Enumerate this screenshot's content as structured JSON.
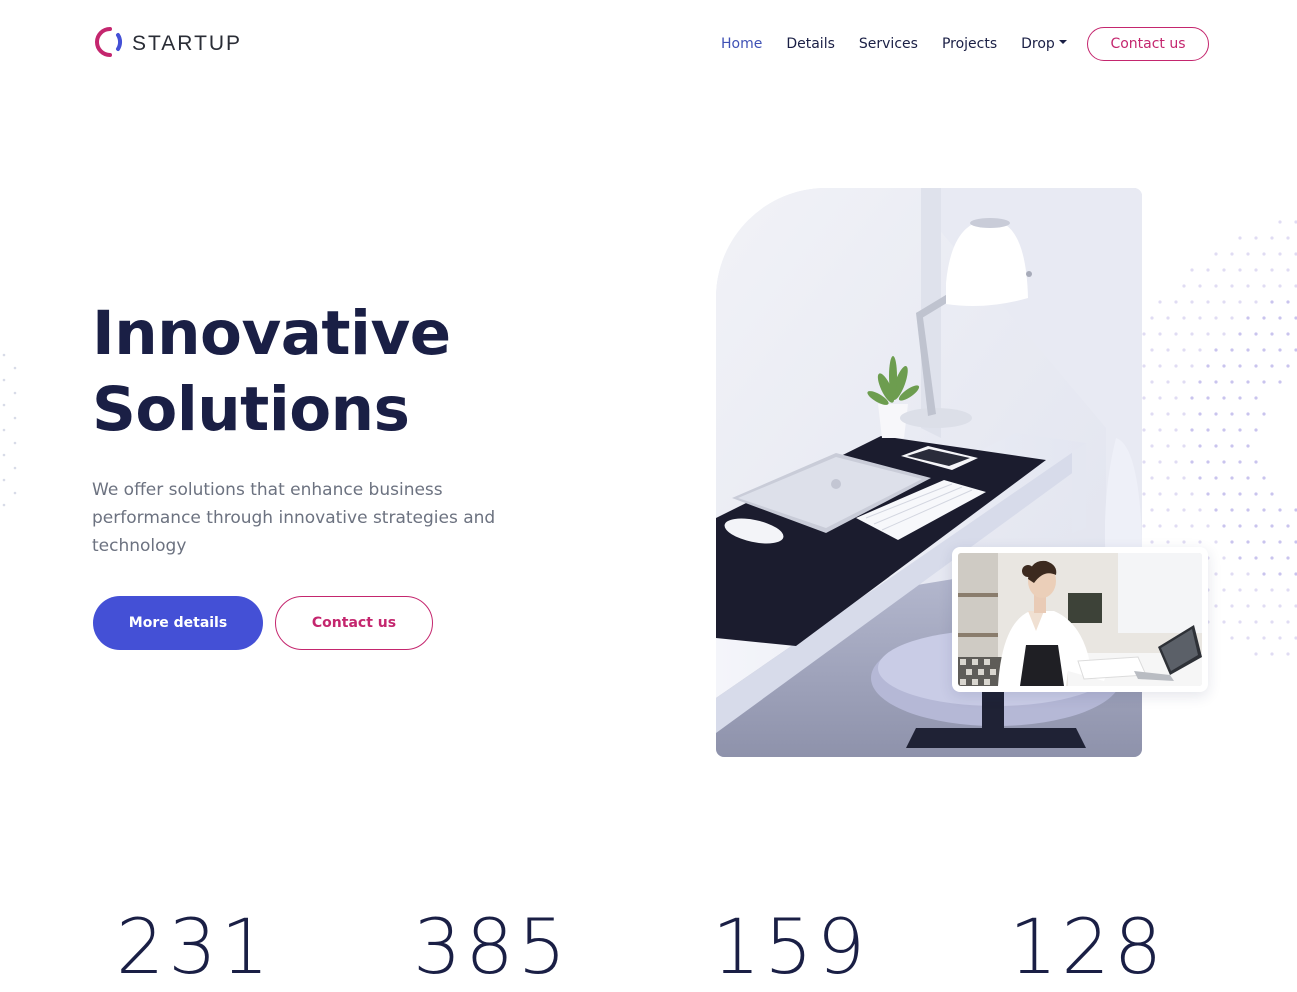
{
  "brand": {
    "name": "STARTUP",
    "logo_icon": "ring-logo-icon",
    "colors": {
      "ring_pink": "#c4266e",
      "ring_blue": "#4450d6"
    }
  },
  "nav": {
    "items": [
      {
        "label": "Home",
        "active": true
      },
      {
        "label": "Details",
        "active": false
      },
      {
        "label": "Services",
        "active": false
      },
      {
        "label": "Projects",
        "active": false
      },
      {
        "label": "Drop",
        "active": false,
        "dropdown": true
      }
    ],
    "contact_label": "Contact us"
  },
  "hero": {
    "title_line1": "Innovative",
    "title_line2": "Solutions",
    "description": "We offer solutions that enhance business performance through innovative strategies and technology",
    "primary_button": "More details",
    "secondary_button": "Contact us"
  },
  "images": {
    "main": "desk-workspace-photo",
    "inset": "woman-working-laptop-photo"
  },
  "stats": [
    {
      "value": "231"
    },
    {
      "value": "385"
    },
    {
      "value": "159"
    },
    {
      "value": "128"
    }
  ],
  "colors": {
    "primary": "#4450d6",
    "accent": "#c4266e",
    "heading": "#1a1f45",
    "body_text": "#6c7280",
    "nav_active": "#3f51b5"
  }
}
